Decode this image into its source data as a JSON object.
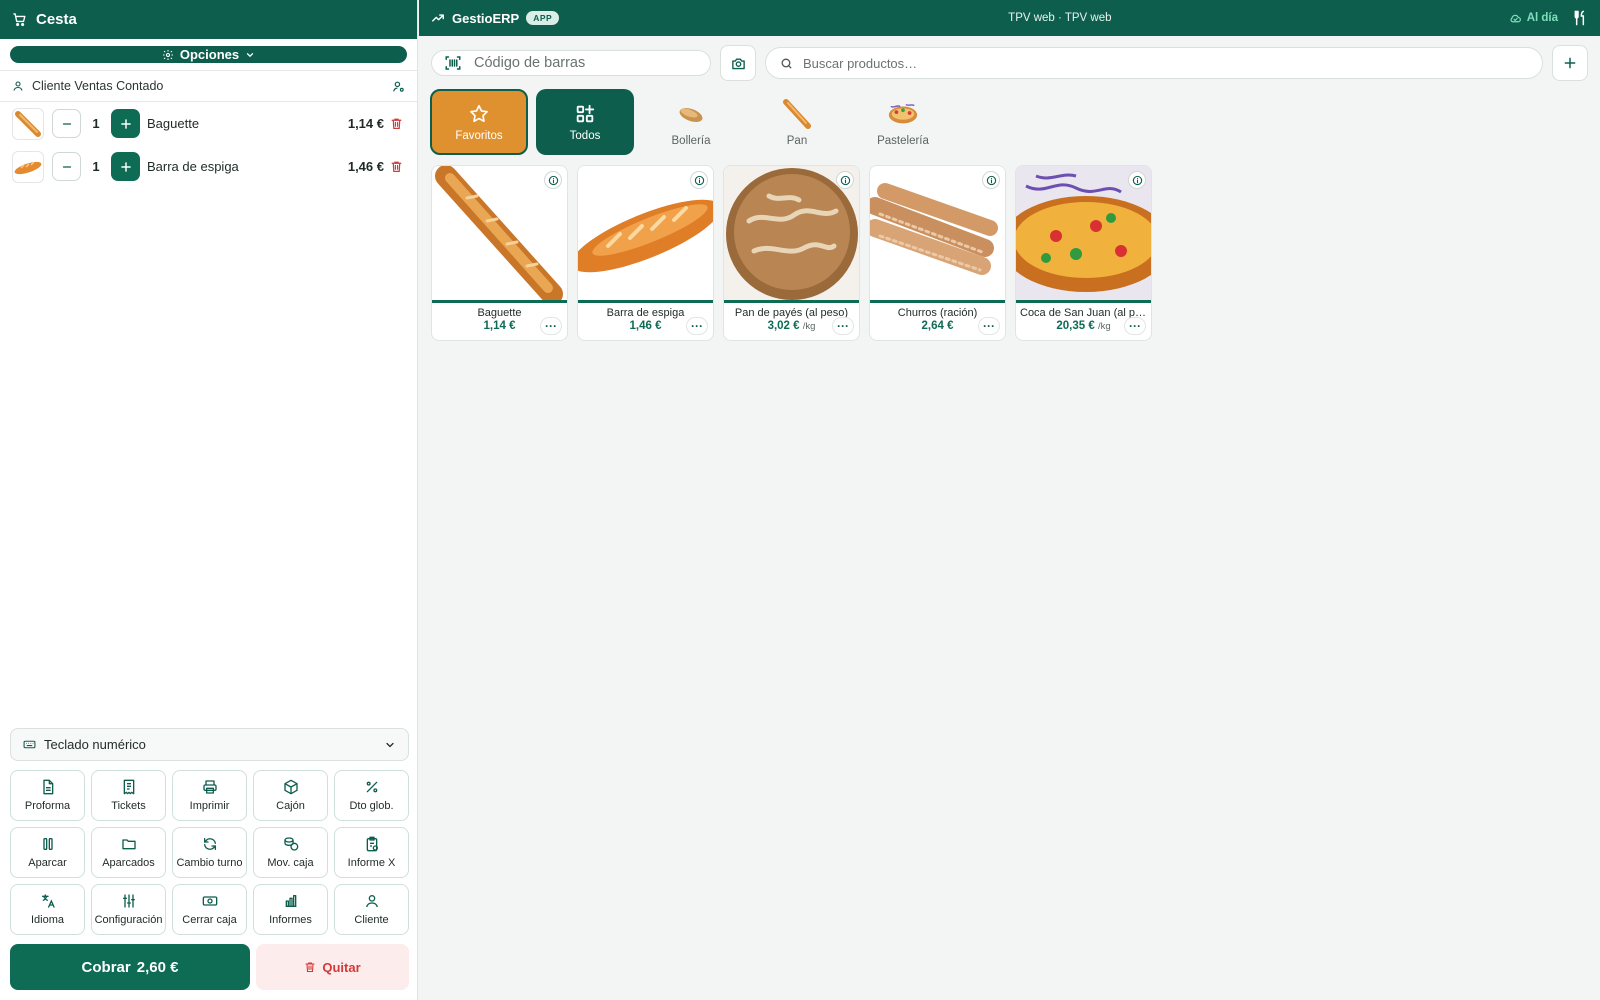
{
  "colors": {
    "primary": "#0e5e4e",
    "accent": "#e0912f",
    "danger": "#d23a3a",
    "price": "#0e6b54"
  },
  "cart": {
    "title": "Cesta",
    "options_label": "Opciones",
    "client_name": "Cliente Ventas Contado",
    "items": [
      {
        "name": "Baguette",
        "qty": "1",
        "price": "1,14 €"
      },
      {
        "name": "Barra de espiga",
        "qty": "1",
        "price": "1,46 €"
      }
    ],
    "keypad_label": "Teclado numérico",
    "actions": [
      {
        "label": "Proforma",
        "icon": "document-icon"
      },
      {
        "label": "Tickets",
        "icon": "receipt-icon"
      },
      {
        "label": "Imprimir",
        "icon": "printer-icon"
      },
      {
        "label": "Cajón",
        "icon": "box-icon"
      },
      {
        "label": "Dto glob.",
        "icon": "percent-icon"
      },
      {
        "label": "Aparcar",
        "icon": "pause-icon"
      },
      {
        "label": "Aparcados",
        "icon": "folder-icon"
      },
      {
        "label": "Cambio turno",
        "icon": "refresh-icon"
      },
      {
        "label": "Mov. caja",
        "icon": "coins-icon"
      },
      {
        "label": "Informe X",
        "icon": "clipboard-icon"
      },
      {
        "label": "Idioma",
        "icon": "language-icon"
      },
      {
        "label": "Configuración",
        "icon": "sliders-icon"
      },
      {
        "label": "Cerrar caja",
        "icon": "banknote-icon"
      },
      {
        "label": "Informes",
        "icon": "bar-chart-icon"
      },
      {
        "label": "Cliente",
        "icon": "user-icon"
      }
    ],
    "pay_label": "Cobrar",
    "total": "2,60 €",
    "remove_label": "Quitar"
  },
  "topbar": {
    "brand": "GestioERP",
    "badge": "APP",
    "title": "TPV web · TPV web",
    "status": "Al día"
  },
  "search": {
    "barcode_placeholder": "Código de barras",
    "product_placeholder": "Buscar productos…"
  },
  "categories": [
    {
      "label": "Favoritos"
    },
    {
      "label": "Todos"
    },
    {
      "label": "Bollería"
    },
    {
      "label": "Pan"
    },
    {
      "label": "Pastelería"
    }
  ],
  "products": [
    {
      "name": "Baguette",
      "price": "1,14 €",
      "unit": ""
    },
    {
      "name": "Barra de espiga",
      "price": "1,46 €",
      "unit": ""
    },
    {
      "name": "Pan de payés (al peso)",
      "price": "3,02 €",
      "unit": "/kg"
    },
    {
      "name": "Churros (ración)",
      "price": "2,64 €",
      "unit": ""
    },
    {
      "name": "Coca de San Juan (al peso)",
      "price": "20,35 €",
      "unit": "/kg"
    }
  ]
}
